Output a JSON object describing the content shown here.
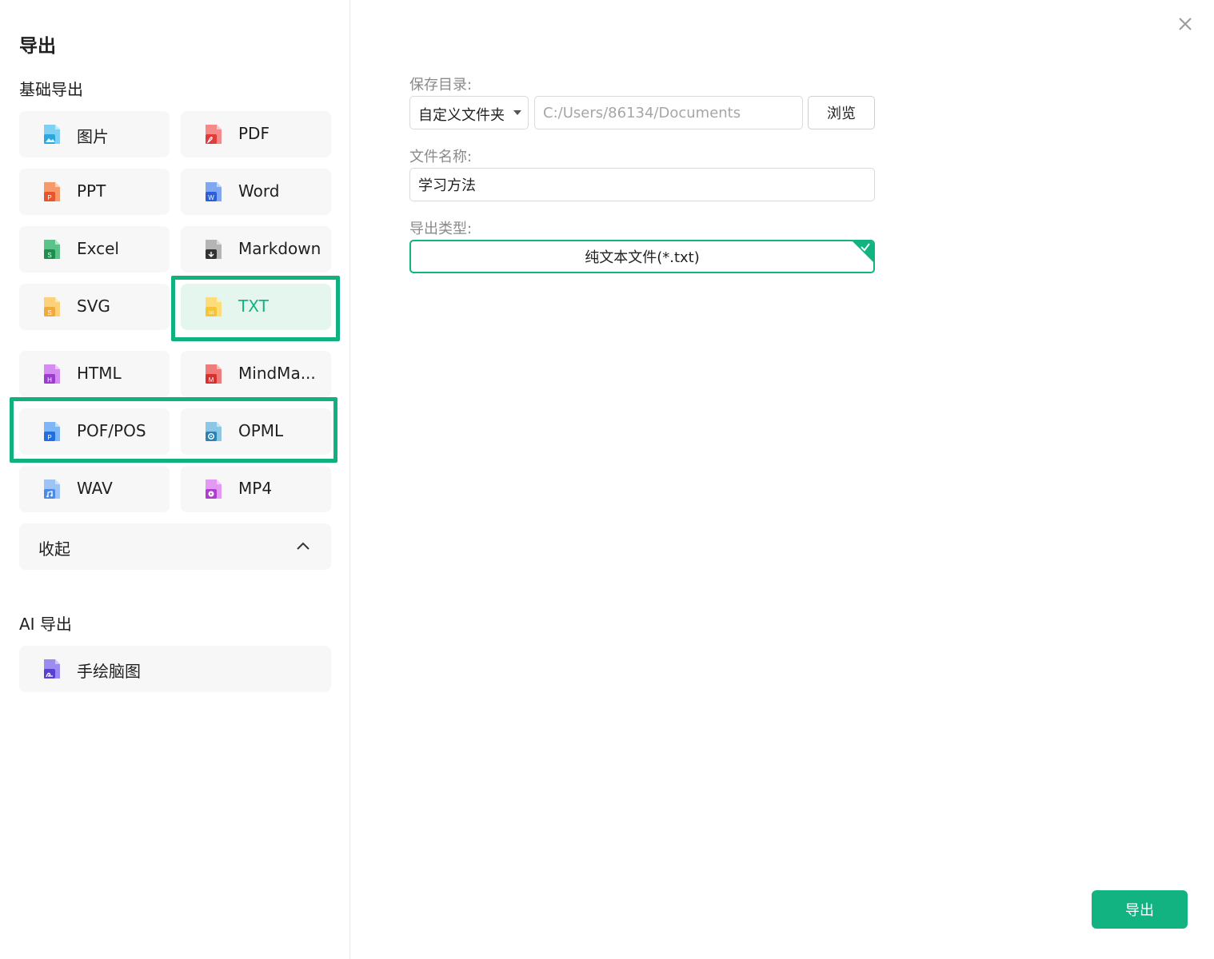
{
  "dialog": {
    "title": "导出",
    "close_icon": "close-icon"
  },
  "basic_export": {
    "title": "基础导出",
    "items": [
      {
        "label": "图片",
        "icon": "image-file-icon"
      },
      {
        "label": "PDF",
        "icon": "pdf-file-icon"
      },
      {
        "label": "PPT",
        "icon": "ppt-file-icon"
      },
      {
        "label": "Word",
        "icon": "word-file-icon"
      },
      {
        "label": "Excel",
        "icon": "excel-file-icon"
      },
      {
        "label": "Markdown",
        "icon": "markdown-file-icon"
      },
      {
        "label": "SVG",
        "icon": "svg-file-icon"
      },
      {
        "label": "TXT",
        "icon": "txt-file-icon",
        "selected": true
      },
      {
        "label": "HTML",
        "icon": "html-file-icon"
      },
      {
        "label": "MindMa...",
        "icon": "mindmanager-file-icon"
      },
      {
        "label": "POF/POS",
        "icon": "pof-file-icon"
      },
      {
        "label": "OPML",
        "icon": "opml-file-icon"
      },
      {
        "label": "WAV",
        "icon": "wav-file-icon"
      },
      {
        "label": "MP4",
        "icon": "mp4-file-icon"
      }
    ],
    "collapse_label": "收起"
  },
  "ai_export": {
    "title": "AI 导出",
    "items": [
      {
        "label": "手绘脑图",
        "icon": "hand-drawn-mindmap-icon"
      }
    ]
  },
  "form": {
    "save_dir_label": "保存目录:",
    "save_dir_select": "自定义文件夹",
    "save_dir_placeholder": "C:/Users/86134/Documents",
    "browse_label": "浏览",
    "file_name_label": "文件名称:",
    "file_name_value": "学习方法",
    "export_type_label": "导出类型:",
    "export_type_value": "纯文本文件(*.txt)"
  },
  "footer": {
    "export_button": "导出"
  },
  "colors": {
    "accent": "#12b281",
    "highlight_box": "#10b07f",
    "tile_bg": "#f7f7f7",
    "selected_tile_bg": "#e4f6ee"
  }
}
